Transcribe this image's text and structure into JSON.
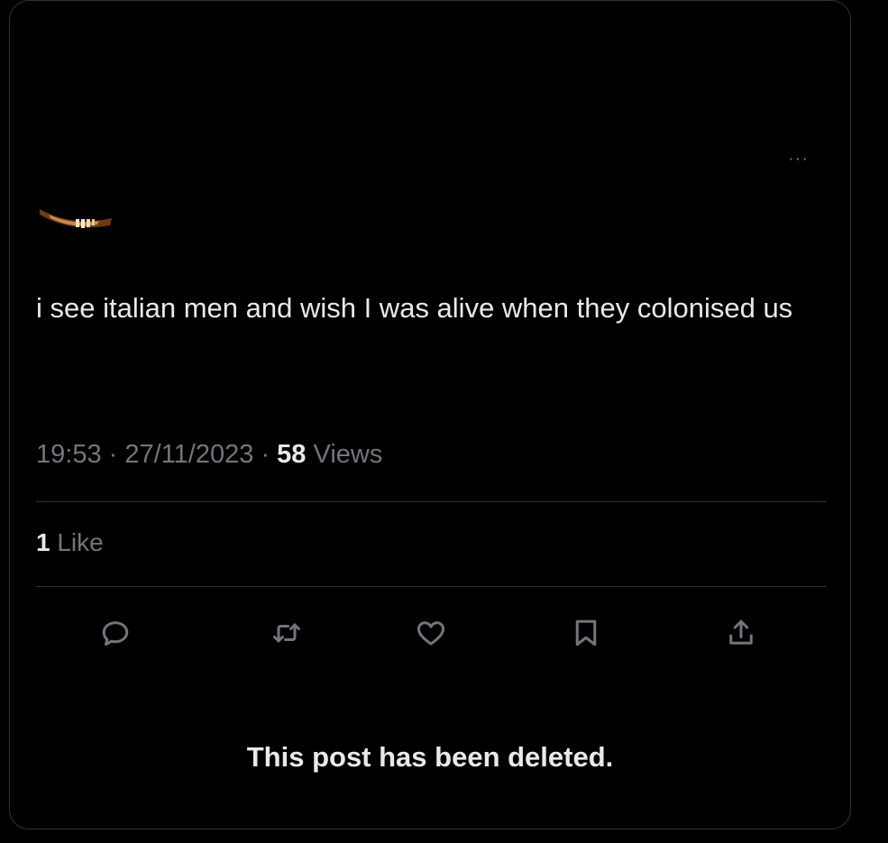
{
  "post": {
    "text": "i see italian men and wish I was alive when they colonised us",
    "time": "19:53",
    "separator": "·",
    "date": "27/11/2023",
    "views_count": "58",
    "views_label": "Views",
    "likes_count": "1",
    "likes_label": "Like"
  },
  "menu": {
    "more_label": "···"
  },
  "actions": [
    "reply-icon",
    "repost-icon",
    "like-icon",
    "bookmark-icon",
    "share-icon"
  ],
  "notice": {
    "deleted_text": "This post has been deleted."
  },
  "colors": {
    "background": "#000000",
    "text_primary": "#e7e9ea",
    "text_secondary": "#71767b",
    "border": "#2f3336"
  }
}
